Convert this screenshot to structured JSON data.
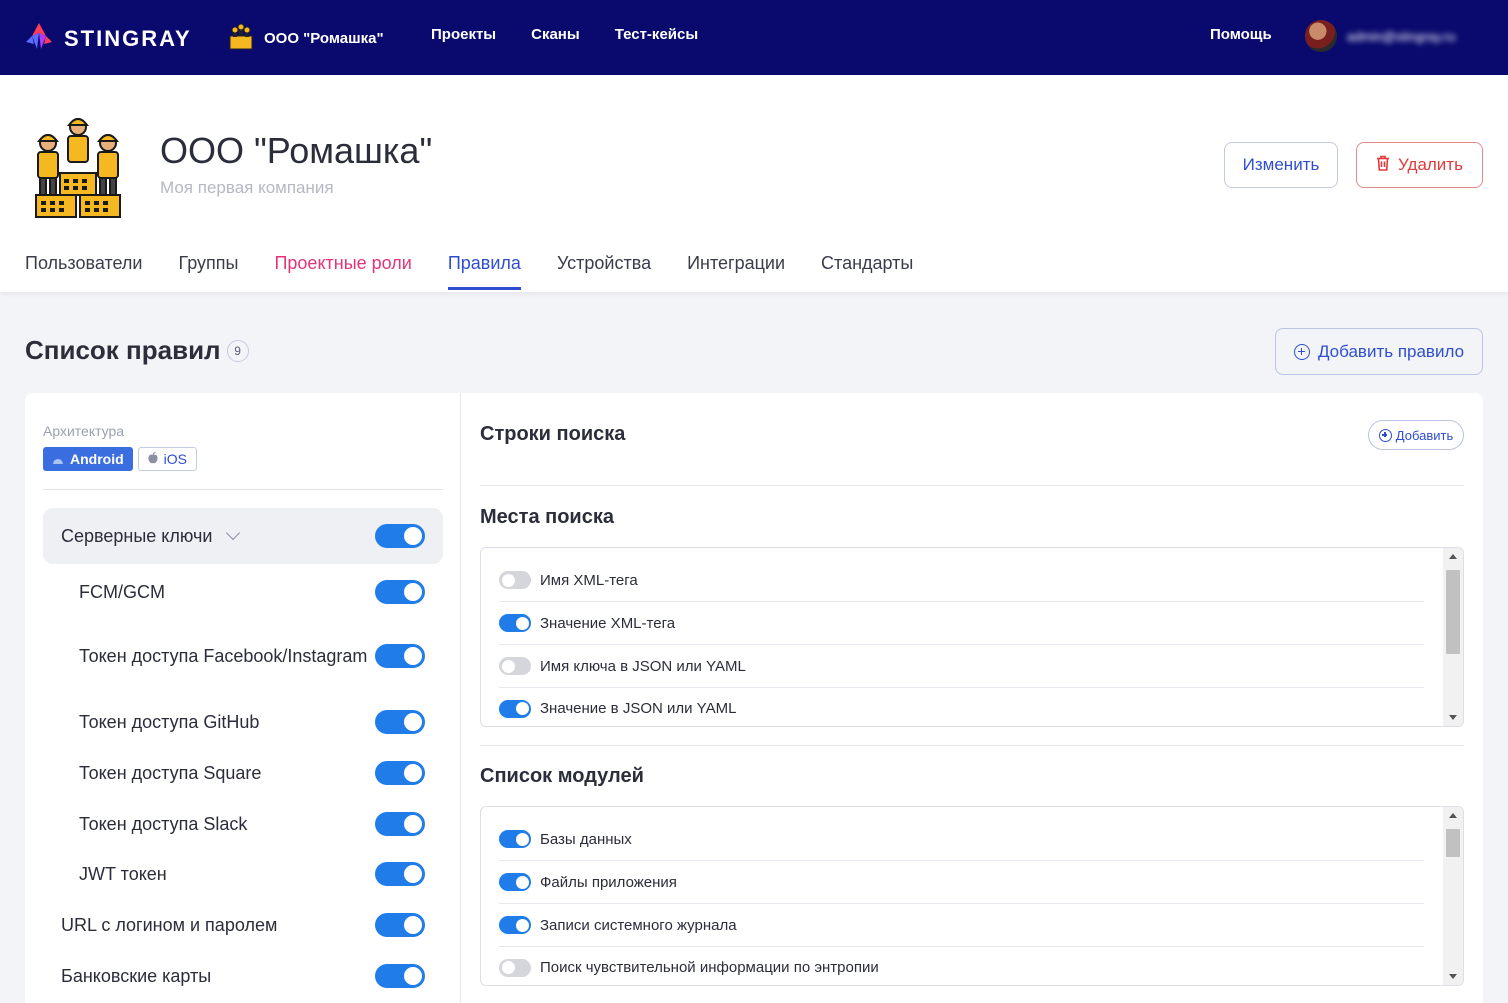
{
  "colors": {
    "nav_bg": "#0a0a6e",
    "accent": "#2e4ecf",
    "toggle_on": "#1f7ce8",
    "toggle_off": "#d4d6dc",
    "pink_tab": "#e3347a",
    "danger": "#e23a3a"
  },
  "topbar": {
    "logo_text": "STINGRAY",
    "logo_icon": "stingray-logo-icon",
    "company_switch": "ООО \"Ромашка\"",
    "nav": [
      "Проекты",
      "Сканы",
      "Тест-кейсы"
    ],
    "help": "Помощь",
    "user_email": "admin@stingray.ru"
  },
  "header": {
    "title": "ООО \"Ромашка\"",
    "subtitle": "Моя первая компания",
    "edit_label": "Изменить",
    "delete_label": "Удалить",
    "tabs": [
      "Пользователи",
      "Группы",
      "Проектные роли",
      "Правила",
      "Устройства",
      "Интеграции",
      "Стандарты"
    ],
    "active_tab": "Правила"
  },
  "rules": {
    "title": "Список правил",
    "count": "9",
    "add_rule_label": "Добавить правило",
    "architecture_label": "Архитектура",
    "arch_android": "Android",
    "arch_ios": "iOS",
    "group": {
      "label": "Серверные ключи",
      "enabled": true
    },
    "children": [
      {
        "label": "FCM/GCM",
        "enabled": true
      },
      {
        "label": "Токен доступа Facebook/Instagram",
        "enabled": true
      },
      {
        "label": "Токен доступа GitHub",
        "enabled": true
      },
      {
        "label": "Токен доступа Square",
        "enabled": true
      },
      {
        "label": "Токен доступа Slack",
        "enabled": true
      },
      {
        "label": "JWT токен",
        "enabled": true
      }
    ],
    "top_level": [
      {
        "label": "URL с логином и паролем",
        "enabled": true
      },
      {
        "label": "Банковские карты",
        "enabled": true
      }
    ]
  },
  "detail": {
    "search_strings_title": "Строки поиска",
    "add_label": "Добавить",
    "search_places_title": "Места поиска",
    "search_places": [
      {
        "label": "Имя XML-тега",
        "enabled": false
      },
      {
        "label": "Значение XML-тега",
        "enabled": true
      },
      {
        "label": "Имя ключа в JSON или YAML",
        "enabled": false
      },
      {
        "label": "Значение в JSON или YAML",
        "enabled": true
      }
    ],
    "modules_title": "Список модулей",
    "modules": [
      {
        "label": "Базы данных",
        "enabled": true
      },
      {
        "label": "Файлы приложения",
        "enabled": true
      },
      {
        "label": "Записи системного журнала",
        "enabled": true
      },
      {
        "label": "Поиск чувствительной информации по энтропии",
        "enabled": false
      }
    ]
  }
}
